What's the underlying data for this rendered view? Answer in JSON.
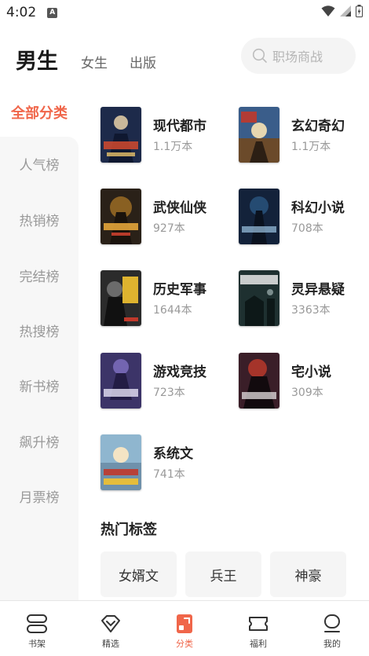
{
  "status": {
    "time": "4:02",
    "notif_letter": "A"
  },
  "header": {
    "tabs": [
      {
        "label": "男生",
        "active": true
      },
      {
        "label": "女生",
        "active": false
      },
      {
        "label": "出版",
        "active": false
      }
    ],
    "search_placeholder": "职场商战"
  },
  "sidebar": {
    "active": "全部分类",
    "items": [
      "人气榜",
      "热销榜",
      "完结榜",
      "热搜榜",
      "新书榜",
      "飙升榜",
      "月票榜"
    ]
  },
  "categories": [
    {
      "name": "现代都市",
      "count": "1.1万本",
      "cover_color": "#1d2a4a"
    },
    {
      "name": "玄幻奇幻",
      "count": "1.1万本",
      "cover_color": "#3a5d8a"
    },
    {
      "name": "武侠仙侠",
      "count": "927本",
      "cover_color": "#2a2118"
    },
    {
      "name": "科幻小说",
      "count": "708本",
      "cover_color": "#13223a"
    },
    {
      "name": "历史军事",
      "count": "1644本",
      "cover_color": "#2b2b2b"
    },
    {
      "name": "灵异悬疑",
      "count": "3363本",
      "cover_color": "#1e3030"
    },
    {
      "name": "游戏竞技",
      "count": "723本",
      "cover_color": "#3c3468"
    },
    {
      "name": "宅小说",
      "count": "309本",
      "cover_color": "#3a1e28"
    },
    {
      "name": "系统文",
      "count": "741本",
      "cover_color": "#8fb6cf"
    }
  ],
  "hot_tags": {
    "title": "热门标签",
    "items": [
      "女婿文",
      "兵王",
      "神豪"
    ]
  },
  "bottom_nav": [
    {
      "label": "书架",
      "icon": "bookshelf-icon",
      "active": false
    },
    {
      "label": "精选",
      "icon": "diamond-icon",
      "active": false
    },
    {
      "label": "分类",
      "icon": "category-icon",
      "active": true
    },
    {
      "label": "福利",
      "icon": "ticket-icon",
      "active": false
    },
    {
      "label": "我的",
      "icon": "profile-icon",
      "active": false
    }
  ],
  "colors": {
    "accent": "#f0664a",
    "sidebar_bg": "#f7f7f7",
    "muted": "#999999"
  }
}
